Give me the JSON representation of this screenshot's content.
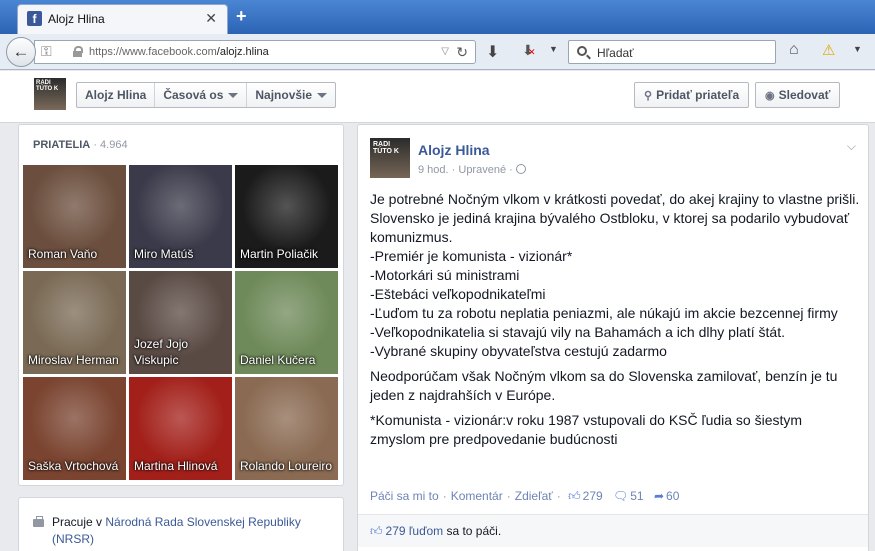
{
  "browser": {
    "tab_title": "Alojz Hlina",
    "tab_favicon": "f",
    "new_tab": "+",
    "url_prefix": "https://www.facebook.com",
    "url_path": "/alojz.hlina",
    "search_placeholder": "Hľadať"
  },
  "header": {
    "name_btn": "Alojz Hlina",
    "timeline_btn": "Časová os",
    "recent_btn": "Najnovšie",
    "add_friend": "Pridať priateľa",
    "follow": "Sledovať",
    "thumb_text": "RADI TÚTO K"
  },
  "friends": {
    "title": "PRIATELIA",
    "count": "· 4.964",
    "items": [
      {
        "name": "Roman Vaňo",
        "bg": "#6b4e3d"
      },
      {
        "name": "Miro Matúš",
        "bg": "#3a3a4a"
      },
      {
        "name": "Martin Poliačik",
        "bg": "#1b1b1b"
      },
      {
        "name": "Miroslav Herman",
        "bg": "#7a6a55"
      },
      {
        "name": "Jozef Jojo Viskupic",
        "bg": "#5a4a44"
      },
      {
        "name": "Daniel Kučera",
        "bg": "#6f8a5a"
      },
      {
        "name": "Saška Vrtochová",
        "bg": "#7a4430"
      },
      {
        "name": "Martina Hlinová",
        "bg": "#a3201a"
      },
      {
        "name": "Rolando Loureiro",
        "bg": "#8a6a52"
      }
    ]
  },
  "work": {
    "prefix": "Pracuje v",
    "org": "Národná Rada Slovenskej Republiky (NRSR)"
  },
  "post": {
    "author": "Alojz Hlina",
    "time": "9 hod.",
    "edited": "· Upravené ·",
    "avatar_text": "RADI TÚTO K",
    "p1_lines": [
      "Je potrebné Nočným vlkom v krátkosti povedať, do akej krajiny to vlastne prišli.",
      "Slovensko je jediná krajina bývalého Ostbloku, v ktorej sa podarilo vybudovať komunizmus.",
      "-Premiér je komunista - vizionár*",
      "-Motorkári sú ministrami",
      "-Eštebáci veľkopodnikateľmi",
      "-Ľuďom tu za robotu neplatia peniazmi, ale núkajú im akcie bezcennej firmy",
      "-Veľkopodnikatelia si stavajú vily na Bahamách a ich dlhy platí štát.",
      "-Vybrané skupiny obyvateľstva cestujú zadarmo"
    ],
    "p2": "Neodporúčam však Nočným vlkom sa do Slovenska zamilovať, benzín je tu jeden z najdrahších v Európe.",
    "p3": "*Komunista - vizionár:v roku 1987 vstupovali do KSČ ľudia so šiestym zmyslom pre predpovedanie budúcnosti",
    "actions": {
      "like": "Páči sa mi to",
      "comment": "Komentár",
      "share": "Zdieľať",
      "likes_count": "279",
      "comments_count": "51",
      "shares_count": "60"
    },
    "likes_line_link": "279 ľuďom",
    "likes_line_rest": " sa to páči."
  }
}
